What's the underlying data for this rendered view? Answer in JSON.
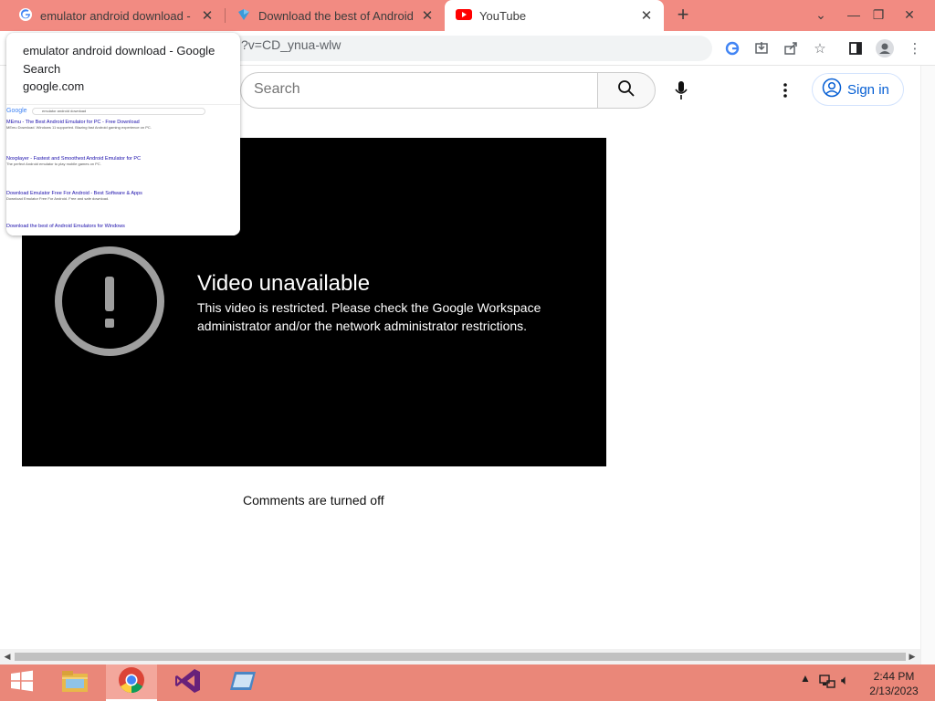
{
  "browser": {
    "tabs": [
      {
        "title": "emulator android download - Go",
        "favicon": "google-g-icon",
        "active": false
      },
      {
        "title": "Download the best of Android E",
        "favicon": "android-emu-icon",
        "active": false
      },
      {
        "title": "YouTube",
        "favicon": "youtube-icon",
        "active": true
      }
    ],
    "address": "?v=CD_ynua-wlw",
    "hover_card": {
      "title": "emulator android download - Google Search",
      "domain": "google.com",
      "thumbnail": {
        "logo": "Google",
        "query": "emulator android download",
        "results": [
          {
            "title": "MEmu - The Best Android Emulator for PC - Free Download",
            "desc": "MEmu Download. Windows 11 supported. Blazing fast Android gaming experience on PC."
          },
          {
            "title": "Noxplayer - Fastest and Smoothest Android Emulator for PC",
            "desc": "The perfect Android emulator to play mobile games on PC."
          },
          {
            "title": "Download Emulator Free For Android - Best Software & Apps",
            "desc": "Download Emulator Free For Android. Free and safe download."
          },
          {
            "title": "Download the best of Android Emulators for Windows",
            "desc": ""
          }
        ]
      }
    }
  },
  "youtube": {
    "search_placeholder": "Search",
    "sign_in_label": "Sign in",
    "error_title": "Video unavailable",
    "error_message": "This video is restricted. Please check the Google Workspace administrator and/or the network administrator restrictions.",
    "comments_status": "Comments are turned off"
  },
  "taskbar": {
    "time": "2:44 PM",
    "date": "2/13/2023"
  },
  "colors": {
    "tabstrip": "#f28b82",
    "taskbar": "#ea8779",
    "youtube_red": "#ff0000",
    "link_blue": "#065fd4"
  }
}
